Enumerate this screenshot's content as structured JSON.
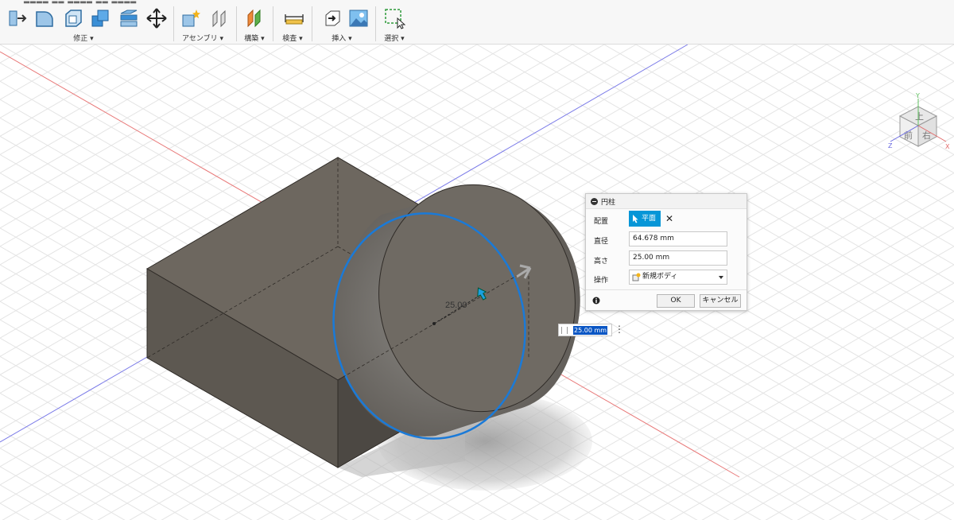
{
  "toolbar": {
    "groups": [
      {
        "label": "修正 ▾"
      },
      {
        "label": "アセンブリ ▾"
      },
      {
        "label": "構築 ▾"
      },
      {
        "label": "検査 ▾"
      },
      {
        "label": "挿入 ▾"
      },
      {
        "label": "選択 ▾"
      }
    ]
  },
  "viewport": {
    "dimension_label": "25.00"
  },
  "viewcube": {
    "faces": {
      "top": "上",
      "front": "前",
      "right": "右"
    },
    "axes": {
      "x": "X",
      "y": "Y",
      "z": "Z"
    }
  },
  "dialog": {
    "title": "円柱",
    "placement_label": "配置",
    "placement_value": "平面",
    "diameter_label": "直径",
    "diameter_value": "64.678 mm",
    "height_label": "高さ",
    "height_value": "25.00 mm",
    "operation_label": "操作",
    "operation_value": "新規ボディ",
    "ok_label": "OK",
    "cancel_label": "キャンセル"
  },
  "inline_input": {
    "value": "25.00 mm"
  },
  "colors": {
    "accent": "#0696d7",
    "selection_outline": "#1a7ad8",
    "body_fill": "#6e675e",
    "x_axis": "#e06060",
    "z_axis": "#6060e0"
  }
}
